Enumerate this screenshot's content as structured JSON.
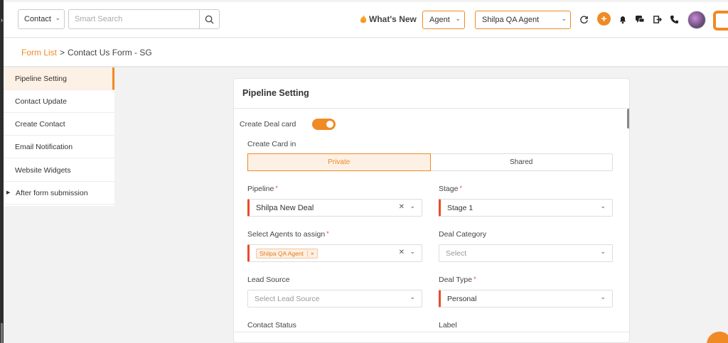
{
  "topbar": {
    "module": "Contact",
    "search_placeholder": "Smart Search",
    "whats_new": "What's New",
    "role": "Agent",
    "agent_name": "Shilpa QA Agent",
    "icons": [
      "refresh-icon",
      "plus-icon",
      "bell-icon",
      "chat-icon",
      "logout-icon",
      "phone-icon"
    ]
  },
  "breadcrumb": {
    "parent": "Form List",
    "separator": ">",
    "current": "Contact Us Form - SG"
  },
  "sidebar": {
    "items": [
      {
        "label": "Pipeline Setting",
        "active": true
      },
      {
        "label": "Contact Update"
      },
      {
        "label": "Create Contact"
      },
      {
        "label": "Email Notification"
      },
      {
        "label": "Website Widgets"
      },
      {
        "label": "After form submission",
        "expandable": true
      }
    ]
  },
  "form": {
    "title": "Pipeline Setting",
    "create_deal_card_label": "Create Deal card",
    "create_deal_card_on": true,
    "create_card_in_label": "Create Card in",
    "create_card_options": [
      "Private",
      "Shared"
    ],
    "create_card_selected": "Private",
    "pipeline_label": "Pipeline",
    "pipeline_value": "Shilpa New Deal",
    "stage_label": "Stage",
    "stage_value": "Stage 1",
    "agents_label": "Select Agents to assign",
    "agents_tags": [
      "Shilpa QA Agent"
    ],
    "deal_category_label": "Deal Category",
    "deal_category_placeholder": "Select",
    "lead_source_label": "Lead Source",
    "lead_source_placeholder": "Select Lead Source",
    "deal_type_label": "Deal Type",
    "deal_type_value": "Personal",
    "contact_status_label": "Contact Status",
    "label_label": "Label",
    "required_mark": "*"
  },
  "colors": {
    "accent": "#f08a24",
    "required": "#e94b2e",
    "active_bg": "#fdf0e4"
  }
}
